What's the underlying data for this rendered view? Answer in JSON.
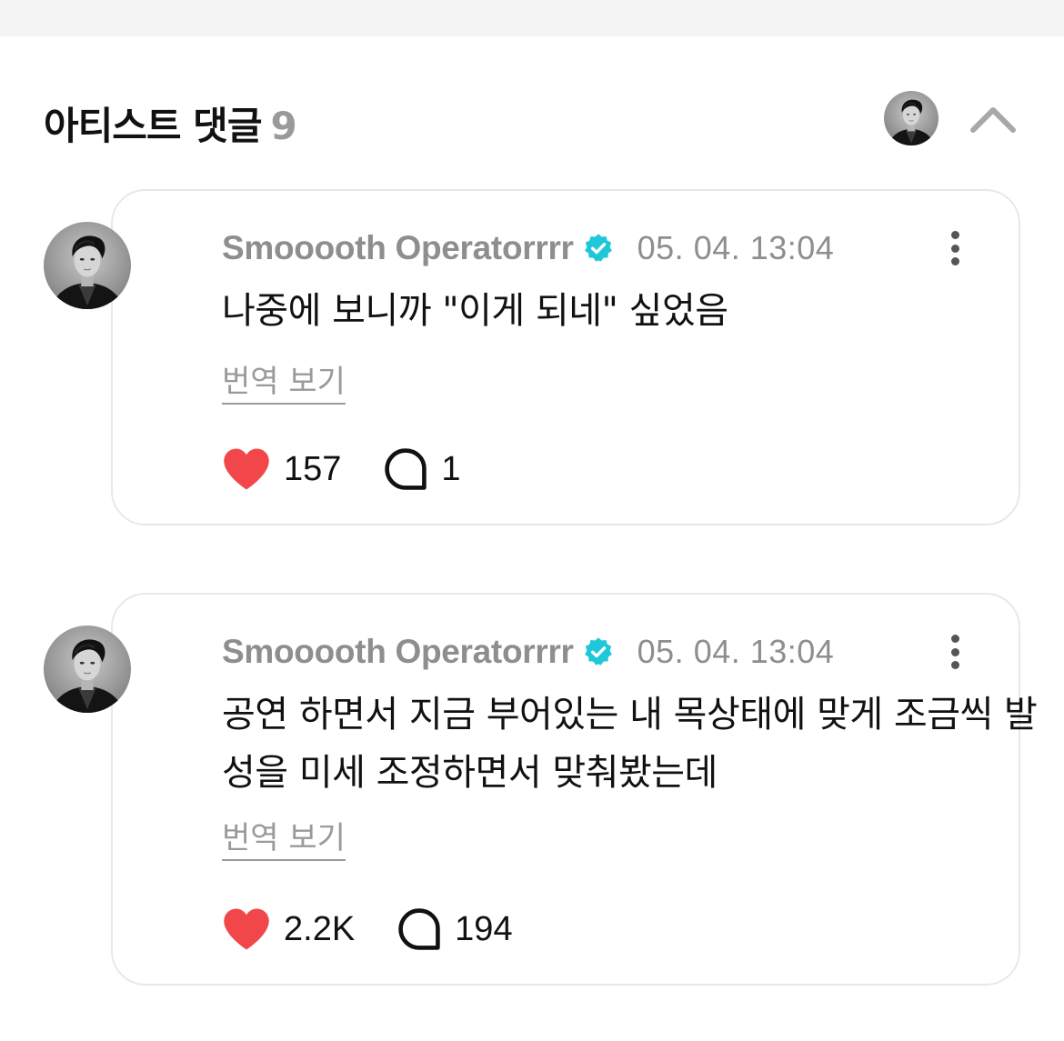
{
  "section": {
    "title": "아티스트 댓글",
    "count": "9"
  },
  "colors": {
    "like": "#f2474a",
    "verified": "#1ec8d8",
    "muted": "#8e8e8e",
    "border": "#e8e8ec"
  },
  "comments": [
    {
      "author": "Smooooth Operatorrrr",
      "time": "05. 04. 13:04",
      "text": "나중에 보니까 \"이게 되네\" 싶었음",
      "translate": "번역 보기",
      "likes": "157",
      "replies": "1"
    },
    {
      "author": "Smooooth Operatorrrr",
      "time": "05. 04. 13:04",
      "text": "공연 하면서 지금 부어있는 내 목상태에 맞게 조금씩 발성을 미세 조정하면서 맞춰봤는데",
      "translate": "번역 보기",
      "likes": "2.2K",
      "replies": "194"
    }
  ]
}
